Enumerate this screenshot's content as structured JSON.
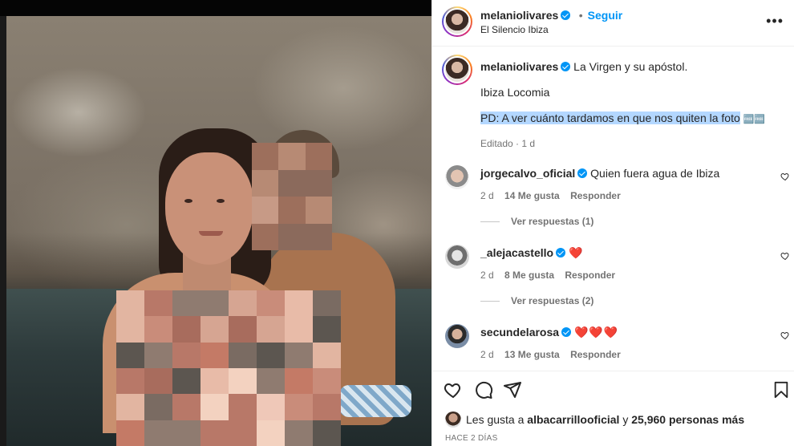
{
  "post": {
    "author": "melaniolivares",
    "location": "El Silencio Ibiza",
    "follow_label": "Seguir",
    "separator": "•",
    "more_label": "•••",
    "caption": {
      "text": "La Virgen y su apóstol.",
      "line2": "Ibiza Locomia",
      "line3": "PD: A ver cuánto tardamos en que nos quiten la foto",
      "line3_emoji": "🆓🆓"
    },
    "edited_label": "Editado",
    "edited_sep": "·",
    "edited_age": "1 d"
  },
  "comments": [
    {
      "user": "jorgecalvo_oficial",
      "text": "Quien fuera agua de Ibiza",
      "age": "2 d",
      "likes": "14 Me gusta",
      "reply": "Responder",
      "view_replies": "Ver respuestas (1)"
    },
    {
      "user": "_alejacastello",
      "text": "❤️",
      "age": "2 d",
      "likes": "8 Me gusta",
      "reply": "Responder",
      "view_replies": "Ver respuestas (2)"
    },
    {
      "user": "secundelarosa",
      "text": "❤️❤️❤️",
      "age": "2 d",
      "likes": "13 Me gusta",
      "reply": "Responder"
    }
  ],
  "likes_line": {
    "prefix": "Les gusta a",
    "user": "albacarrillooficial",
    "middle": "y",
    "count": "25,960 personas más"
  },
  "timestamp": "HACE 2 DÍAS",
  "icons": {
    "like": "heart-icon",
    "comment": "comment-bubble-icon",
    "share": "paper-plane-icon",
    "save": "bookmark-icon",
    "verified": "verified-badge-icon",
    "more": "more-options-icon"
  },
  "colors": {
    "link_blue": "#0095f6",
    "verified_blue": "#0095f6",
    "text": "#262626",
    "muted": "#737373",
    "selection": "#b3d7ff"
  }
}
